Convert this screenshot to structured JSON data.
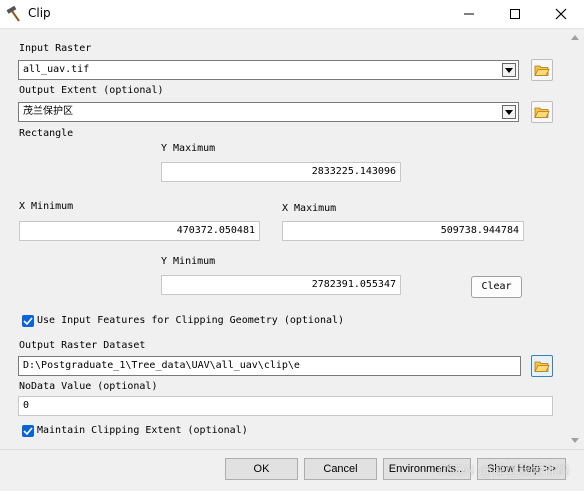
{
  "window": {
    "title": "Clip",
    "icon": "hammer-icon"
  },
  "input_raster": {
    "label": "Input Raster",
    "value": "all_uav.tif"
  },
  "output_extent": {
    "label": "Output Extent (optional)",
    "value": "茂兰保护区"
  },
  "rectangle": {
    "label": "Rectangle",
    "y_max_label": "Y Maximum",
    "y_max_value": "2833225.143096",
    "x_min_label": "X Minimum",
    "x_min_value": "470372.050481",
    "x_max_label": "X Maximum",
    "x_max_value": "509738.944784",
    "y_min_label": "Y Minimum",
    "y_min_value": "2782391.055347",
    "clear_label": "Clear"
  },
  "use_input_features": {
    "label": "Use Input Features for Clipping Geometry (optional)",
    "checked": true
  },
  "output_raster": {
    "label": "Output Raster Dataset",
    "value": "D:\\Postgraduate_1\\Tree_data\\UAV\\all_uav\\clip\\e"
  },
  "nodata": {
    "label": "NoData Value (optional)",
    "value": "0"
  },
  "maintain_extent": {
    "label": "Maintain Clipping Extent (optional)",
    "checked": true
  },
  "footer": {
    "ok_label": "OK",
    "cancel_label": "Cancel",
    "environments_label": "Environments...",
    "show_help_label": "Show Help >>",
    "watermark": "CSDN @撑住我爱你码"
  }
}
